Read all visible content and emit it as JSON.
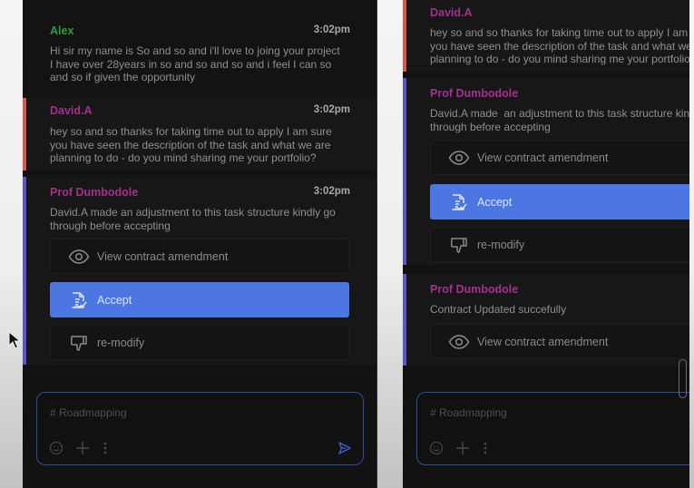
{
  "colors": {
    "panel_bg": "#121212",
    "message_bg": "#171717",
    "alex_name": "#2e9e3e",
    "david_name": "#a4308f",
    "prof_name": "#a4308f",
    "david_bar": "#d9574b",
    "prof_bar": "#5b56c7",
    "accept_bg": "#4c76e2",
    "composer_border": "#2f4d9c",
    "send_icon": "#3d5fc5"
  },
  "left_panel": {
    "messages": [
      {
        "author": "Alex",
        "time": "3:02pm",
        "text": "Hi sir my name is So and so and i'll love to joing your project\nI have over 28years in so and so and so and i feel I can so\nand so if given the opportunity"
      },
      {
        "author": "David.A",
        "time": "3:02pm",
        "text": "hey so and so thanks for taking time out to apply I am sure\nyou have seen the description of the task and what we are\nplanning to do - do you mind sharing me your portfolio?"
      },
      {
        "author": "Prof Dumbodole",
        "time": "3:02pm",
        "text": "David.A made  an adjustment to this task structure kindly go\nthrough before accepting",
        "actions": [
          {
            "label": "View contract amendment",
            "icon": "eye-icon"
          },
          {
            "label": "Accept",
            "icon": "document-check-icon"
          },
          {
            "label": "re-modify",
            "icon": "thumbs-down-icon"
          }
        ]
      }
    ],
    "composer": {
      "placeholder": "# Roadmapping",
      "tools": [
        "emoji-icon",
        "plus-icon",
        "more-vertical-icon"
      ],
      "send_icon": "send-icon"
    }
  },
  "right_panel": {
    "messages": [
      {
        "author": "David.A",
        "text": "hey so and so thanks for taking time out to apply I am sure\nyou have seen the description of the task and what we are\nplanning to do - do you mind sharing me your portfolio?"
      },
      {
        "author": "Prof Dumbodole",
        "text": "David.A made  an adjustment to this task structure kindly go\nthrough before accepting",
        "actions": [
          {
            "label": "View contract amendment",
            "icon": "eye-icon"
          },
          {
            "label": "Accept",
            "icon": "document-check-icon"
          },
          {
            "label": "re-modify",
            "icon": "thumbs-down-icon"
          }
        ]
      },
      {
        "author": "Prof Dumbodole",
        "text": "Contract Updated succefully",
        "actions": [
          {
            "label": "View contract amendment",
            "icon": "eye-icon"
          }
        ]
      }
    ],
    "composer": {
      "placeholder": "# Roadmapping",
      "tools": [
        "emoji-icon",
        "plus-icon",
        "more-vertical-icon"
      ]
    }
  }
}
